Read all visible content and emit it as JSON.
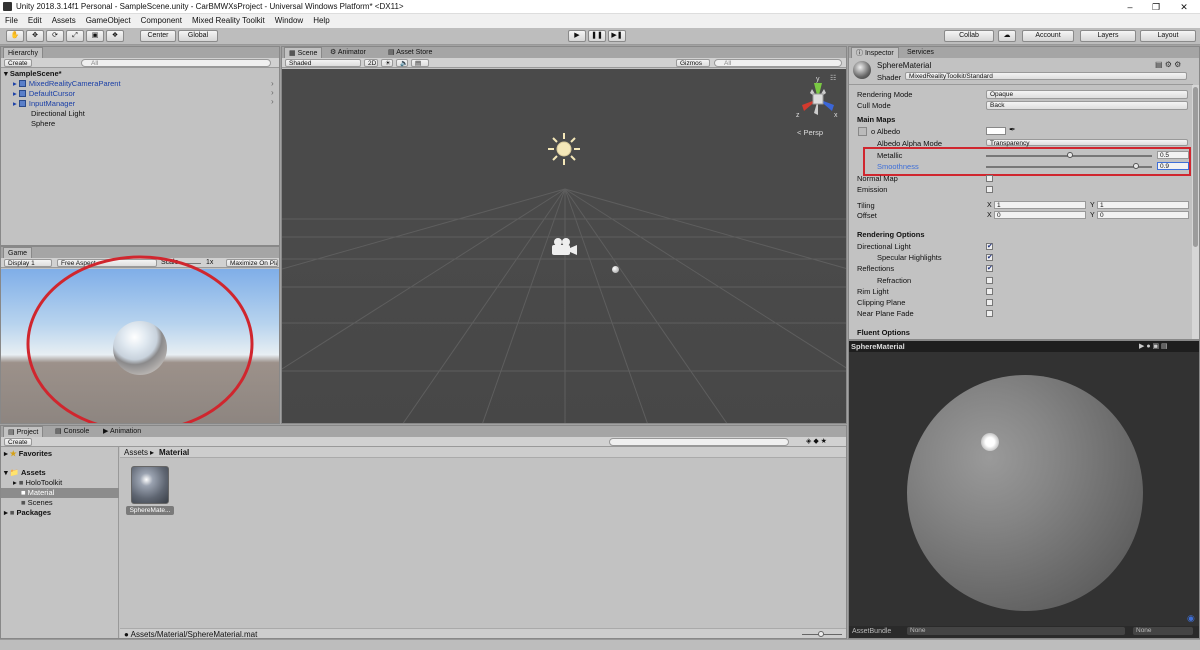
{
  "window": {
    "title": "Unity 2018.3.14f1 Personal - SampleScene.unity - CarBMWXsProject - Universal Windows Platform* <DX11>"
  },
  "menu": [
    "File",
    "Edit",
    "Assets",
    "GameObject",
    "Component",
    "Mixed Reality Toolkit",
    "Window",
    "Help"
  ],
  "toolbar": {
    "center": "Center",
    "global": "Global",
    "collab": "Collab",
    "account": "Account",
    "layers": "Layers",
    "layout": "Layout"
  },
  "hierarchy": {
    "tab": "Hierarchy",
    "create": "Create",
    "search": "All",
    "scene": "SampleScene*",
    "items": [
      {
        "label": "MixedRealityCameraParent",
        "prefab": true
      },
      {
        "label": "DefaultCursor",
        "prefab": true
      },
      {
        "label": "InputManager",
        "prefab": true
      },
      {
        "label": "Directional Light",
        "prefab": false
      },
      {
        "label": "Sphere",
        "prefab": false
      }
    ]
  },
  "game": {
    "tab": "Game",
    "display": "Display 1",
    "aspect": "Free Aspect",
    "scale_label": "Scale",
    "scale_value": "1x",
    "maximize": "Maximize On Pla"
  },
  "scene": {
    "tabs": [
      "Scene",
      "Animator",
      "Asset Store"
    ],
    "shading": "Shaded",
    "mode": "2D",
    "gizmos": "Gizmos",
    "search": "All",
    "persp": "< Persp",
    "gizmo_axes": {
      "x": "x",
      "y": "y",
      "z": "z"
    }
  },
  "project": {
    "tabs": [
      "Project",
      "Console",
      "Animation"
    ],
    "create": "Create",
    "favorites": "Favorites",
    "assets": "Assets",
    "folders": [
      "HoloToolkit",
      "Material",
      "Scenes"
    ],
    "packages": "Packages",
    "breadcrumb": [
      "Assets",
      "Material"
    ],
    "asset_name": "SphereMate...",
    "path": "Assets/Material/SphereMaterial.mat"
  },
  "inspector": {
    "tabs": [
      "Inspector",
      "Services"
    ],
    "material_name": "SphereMaterial",
    "shader_label": "Shader",
    "shader_value": "MixedRealityToolkit/Standard",
    "rendering_mode": {
      "label": "Rendering Mode",
      "value": "Opaque"
    },
    "cull_mode": {
      "label": "Cull Mode",
      "value": "Back"
    },
    "main_maps": "Main Maps",
    "albedo": "o Albedo",
    "albedo_alpha": "Albedo Alpha Mode",
    "albedo_alpha_value": "Transparency",
    "metallic": {
      "label": "Metallic",
      "value": "0.5",
      "level": 0.5
    },
    "smoothness": {
      "label": "Smoothness",
      "value": "0.9",
      "level": 0.9
    },
    "normal_map": "Normal Map",
    "emission": "Emission",
    "tiling": {
      "label": "Tiling",
      "x": "1",
      "y": "1"
    },
    "offset": {
      "label": "Offset",
      "x": "0",
      "y": "0"
    },
    "rendering_options": "Rendering Options",
    "options": [
      {
        "label": "Directional Light",
        "checked": true,
        "indent": false
      },
      {
        "label": "Specular Highlights",
        "checked": true,
        "indent": true
      },
      {
        "label": "Reflections",
        "checked": true,
        "indent": false
      },
      {
        "label": "Refraction",
        "checked": false,
        "indent": true
      },
      {
        "label": "Rim Light",
        "checked": false,
        "indent": false
      },
      {
        "label": "Clipping Plane",
        "checked": false,
        "indent": false
      },
      {
        "label": "Near Plane Fade",
        "checked": false,
        "indent": false
      }
    ],
    "fluent_options": "Fluent Options",
    "preview_title": "SphereMaterial",
    "asset_bundle": "AssetBundle",
    "bundle_value": "None",
    "bundle_variant": "None"
  },
  "colors": {
    "highlight_red": "#d0262e",
    "accent_blue": "#3e6fd8"
  }
}
